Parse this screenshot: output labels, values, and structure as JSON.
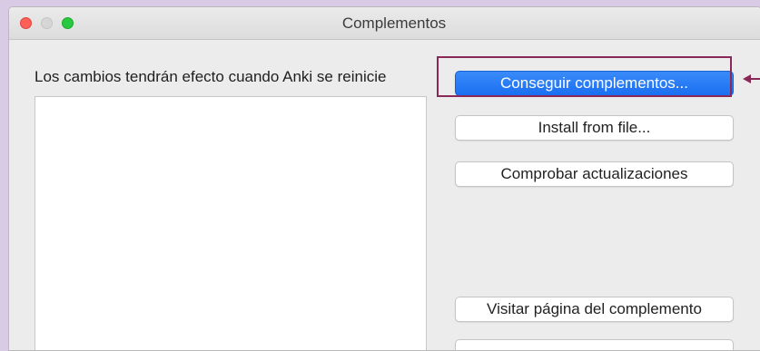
{
  "window": {
    "title": "Complementos"
  },
  "content": {
    "notice": "Los cambios tendrán efecto cuando Anki se reinicie"
  },
  "buttons": {
    "get_addons": "Conseguir complementos...",
    "install_from_file": "Install from file...",
    "check_updates": "Comprobar actualizaciones",
    "visit_page": "Visitar página del complemento",
    "partial_bottom": ""
  },
  "annotation": {
    "highlight_color": "#8a2957",
    "arrow_color": "#8a2957"
  },
  "colors": {
    "background": "#d9cbe6",
    "primary_button": "#1a6ff2",
    "traffic_close": "#fe5f57",
    "traffic_max": "#28c840"
  }
}
